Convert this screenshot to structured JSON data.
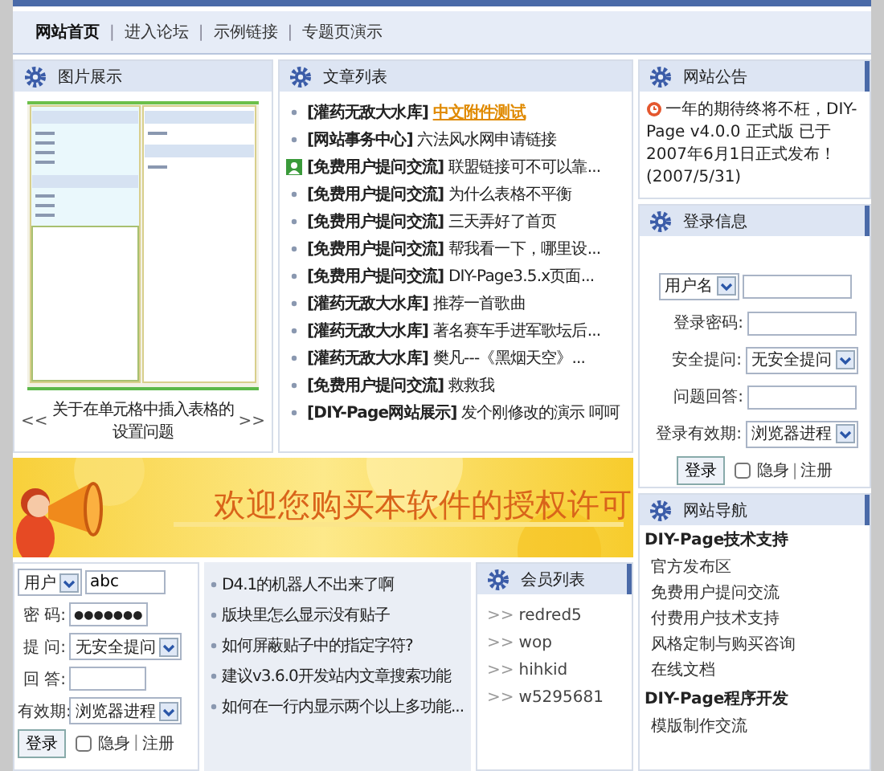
{
  "nav": {
    "separator": "|",
    "items": [
      {
        "label": "网站首页",
        "selected": true
      },
      {
        "label": "进入论坛",
        "selected": false
      },
      {
        "label": "示例链接",
        "selected": false
      },
      {
        "label": "专题页演示",
        "selected": false
      }
    ]
  },
  "gallery": {
    "title": "图片展示",
    "prev": "<<",
    "caption": "关于在单元格中插入表格的设置问题",
    "next": ">>"
  },
  "articles": {
    "title": "文章列表",
    "items": [
      {
        "user_icon": false,
        "category": "[灌药无敌大水库]",
        "title": "中文附件测试",
        "highlighted": true
      },
      {
        "user_icon": false,
        "category": "[网站事务中心]",
        "title": "六法风水网申请链接",
        "highlighted": false
      },
      {
        "user_icon": true,
        "category": "[免费用户提问交流]",
        "title": "联盟链接可不可以靠...",
        "highlighted": false
      },
      {
        "user_icon": false,
        "category": "[免费用户提问交流]",
        "title": "为什么表格不平衡",
        "highlighted": false
      },
      {
        "user_icon": false,
        "category": "[免费用户提问交流]",
        "title": "三天弄好了首页",
        "highlighted": false
      },
      {
        "user_icon": false,
        "category": "[免费用户提问交流]",
        "title": "帮我看一下，哪里设...",
        "highlighted": false
      },
      {
        "user_icon": false,
        "category": "[免费用户提问交流]",
        "title": "DIY-Page3.5.x页面...",
        "highlighted": false
      },
      {
        "user_icon": false,
        "category": "[灌药无敌大水库]",
        "title": "推荐一首歌曲",
        "highlighted": false
      },
      {
        "user_icon": false,
        "category": "[灌药无敌大水库]",
        "title": "著名赛车手进军歌坛后...",
        "highlighted": false
      },
      {
        "user_icon": false,
        "category": "[灌药无敌大水库]",
        "title": "樊凡---《黑烟天空》...",
        "highlighted": false
      },
      {
        "user_icon": false,
        "category": "[免费用户提问交流]",
        "title": "救救我",
        "highlighted": false
      },
      {
        "user_icon": false,
        "category": "[DIY-Page网站展示]",
        "title": "发个刚修改的演示 呵呵",
        "highlighted": false
      }
    ]
  },
  "notice": {
    "title": "网站公告",
    "text": "一年的期待终将不枉，DIY-Page v4.0.0 正式版 已于2007年6月1日正式发布！",
    "date": "(2007/5/31)"
  },
  "login": {
    "title": "登录信息",
    "user_select": "用户名",
    "password_label": "登录密码:",
    "question_label": "安全提问:",
    "question_select": "无安全提问",
    "answer_label": "问题回答:",
    "expiry_label": "登录有效期:",
    "expiry_select": "浏览器进程",
    "submit": "登录",
    "invisible": {
      "label": "隐身",
      "checked": false
    },
    "separator": "|",
    "register": "注册"
  },
  "banner": {
    "text": "欢迎您购买本软件的授权许可"
  },
  "mini_login": {
    "user_select": "用户",
    "username": "abc",
    "password_label": "密 码:",
    "password": "●●●●●●●",
    "question_label": "提 问:",
    "question_select": "无安全提问",
    "answer_label": "回 答:",
    "expiry_label": "有效期:",
    "expiry_select": "浏览器进程",
    "submit": "登录",
    "invisible": {
      "label": "隐身",
      "checked": false
    },
    "separator": "|",
    "register": "注册"
  },
  "posts": [
    "D4.1的机器人不出来了啊",
    "版块里怎么显示没有贴子",
    "如何屏蔽贴子中的指定字符?",
    "建议v3.6.0开发站内文章搜索功能",
    "如何在一行内显示两个以上多功能..."
  ],
  "members": {
    "title": "会员列表",
    "items": [
      {
        "marker": ">>",
        "name": "redred5"
      },
      {
        "marker": ">>",
        "name": "wop"
      },
      {
        "marker": ">>",
        "name": "hihkid"
      },
      {
        "marker": ">>",
        "name": "w5295681"
      }
    ]
  },
  "site_nav": {
    "title": "网站导航",
    "groups": [
      {
        "heading": "DIY-Page技术支持",
        "links": [
          "官方发布区",
          "免费用户提问交流",
          "付费用户技术支持",
          "风格定制与购买咨询",
          "在线文档"
        ]
      },
      {
        "heading": "DIY-Page程序开发",
        "links": [
          "模版制作交流"
        ]
      }
    ]
  }
}
